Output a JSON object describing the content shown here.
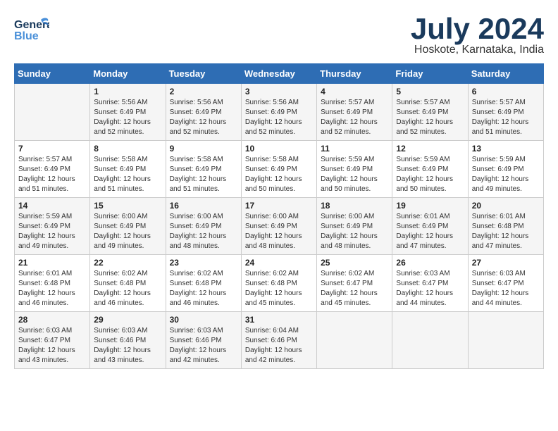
{
  "header": {
    "logo_general": "General",
    "logo_blue": "Blue",
    "month_year": "July 2024",
    "location": "Hoskote, Karnataka, India"
  },
  "days_of_week": [
    "Sunday",
    "Monday",
    "Tuesday",
    "Wednesday",
    "Thursday",
    "Friday",
    "Saturday"
  ],
  "weeks": [
    [
      {
        "day": "",
        "info": ""
      },
      {
        "day": "1",
        "info": "Sunrise: 5:56 AM\nSunset: 6:49 PM\nDaylight: 12 hours\nand 52 minutes."
      },
      {
        "day": "2",
        "info": "Sunrise: 5:56 AM\nSunset: 6:49 PM\nDaylight: 12 hours\nand 52 minutes."
      },
      {
        "day": "3",
        "info": "Sunrise: 5:56 AM\nSunset: 6:49 PM\nDaylight: 12 hours\nand 52 minutes."
      },
      {
        "day": "4",
        "info": "Sunrise: 5:57 AM\nSunset: 6:49 PM\nDaylight: 12 hours\nand 52 minutes."
      },
      {
        "day": "5",
        "info": "Sunrise: 5:57 AM\nSunset: 6:49 PM\nDaylight: 12 hours\nand 52 minutes."
      },
      {
        "day": "6",
        "info": "Sunrise: 5:57 AM\nSunset: 6:49 PM\nDaylight: 12 hours\nand 51 minutes."
      }
    ],
    [
      {
        "day": "7",
        "info": "Sunrise: 5:57 AM\nSunset: 6:49 PM\nDaylight: 12 hours\nand 51 minutes."
      },
      {
        "day": "8",
        "info": "Sunrise: 5:58 AM\nSunset: 6:49 PM\nDaylight: 12 hours\nand 51 minutes."
      },
      {
        "day": "9",
        "info": "Sunrise: 5:58 AM\nSunset: 6:49 PM\nDaylight: 12 hours\nand 51 minutes."
      },
      {
        "day": "10",
        "info": "Sunrise: 5:58 AM\nSunset: 6:49 PM\nDaylight: 12 hours\nand 50 minutes."
      },
      {
        "day": "11",
        "info": "Sunrise: 5:59 AM\nSunset: 6:49 PM\nDaylight: 12 hours\nand 50 minutes."
      },
      {
        "day": "12",
        "info": "Sunrise: 5:59 AM\nSunset: 6:49 PM\nDaylight: 12 hours\nand 50 minutes."
      },
      {
        "day": "13",
        "info": "Sunrise: 5:59 AM\nSunset: 6:49 PM\nDaylight: 12 hours\nand 49 minutes."
      }
    ],
    [
      {
        "day": "14",
        "info": "Sunrise: 5:59 AM\nSunset: 6:49 PM\nDaylight: 12 hours\nand 49 minutes."
      },
      {
        "day": "15",
        "info": "Sunrise: 6:00 AM\nSunset: 6:49 PM\nDaylight: 12 hours\nand 49 minutes."
      },
      {
        "day": "16",
        "info": "Sunrise: 6:00 AM\nSunset: 6:49 PM\nDaylight: 12 hours\nand 48 minutes."
      },
      {
        "day": "17",
        "info": "Sunrise: 6:00 AM\nSunset: 6:49 PM\nDaylight: 12 hours\nand 48 minutes."
      },
      {
        "day": "18",
        "info": "Sunrise: 6:00 AM\nSunset: 6:49 PM\nDaylight: 12 hours\nand 48 minutes."
      },
      {
        "day": "19",
        "info": "Sunrise: 6:01 AM\nSunset: 6:49 PM\nDaylight: 12 hours\nand 47 minutes."
      },
      {
        "day": "20",
        "info": "Sunrise: 6:01 AM\nSunset: 6:48 PM\nDaylight: 12 hours\nand 47 minutes."
      }
    ],
    [
      {
        "day": "21",
        "info": "Sunrise: 6:01 AM\nSunset: 6:48 PM\nDaylight: 12 hours\nand 46 minutes."
      },
      {
        "day": "22",
        "info": "Sunrise: 6:02 AM\nSunset: 6:48 PM\nDaylight: 12 hours\nand 46 minutes."
      },
      {
        "day": "23",
        "info": "Sunrise: 6:02 AM\nSunset: 6:48 PM\nDaylight: 12 hours\nand 46 minutes."
      },
      {
        "day": "24",
        "info": "Sunrise: 6:02 AM\nSunset: 6:48 PM\nDaylight: 12 hours\nand 45 minutes."
      },
      {
        "day": "25",
        "info": "Sunrise: 6:02 AM\nSunset: 6:47 PM\nDaylight: 12 hours\nand 45 minutes."
      },
      {
        "day": "26",
        "info": "Sunrise: 6:03 AM\nSunset: 6:47 PM\nDaylight: 12 hours\nand 44 minutes."
      },
      {
        "day": "27",
        "info": "Sunrise: 6:03 AM\nSunset: 6:47 PM\nDaylight: 12 hours\nand 44 minutes."
      }
    ],
    [
      {
        "day": "28",
        "info": "Sunrise: 6:03 AM\nSunset: 6:47 PM\nDaylight: 12 hours\nand 43 minutes."
      },
      {
        "day": "29",
        "info": "Sunrise: 6:03 AM\nSunset: 6:46 PM\nDaylight: 12 hours\nand 43 minutes."
      },
      {
        "day": "30",
        "info": "Sunrise: 6:03 AM\nSunset: 6:46 PM\nDaylight: 12 hours\nand 42 minutes."
      },
      {
        "day": "31",
        "info": "Sunrise: 6:04 AM\nSunset: 6:46 PM\nDaylight: 12 hours\nand 42 minutes."
      },
      {
        "day": "",
        "info": ""
      },
      {
        "day": "",
        "info": ""
      },
      {
        "day": "",
        "info": ""
      }
    ]
  ]
}
